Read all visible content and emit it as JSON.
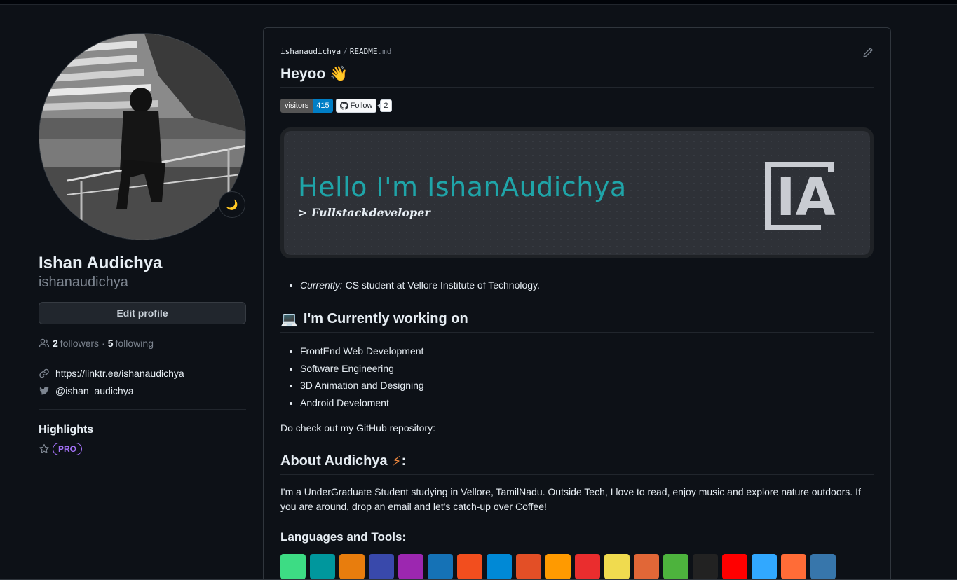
{
  "sidebar": {
    "name": "Ishan Audichya",
    "login": "ishanaudichya",
    "edit_profile": "Edit profile",
    "followers_count": "2",
    "followers_label": "followers",
    "separator": "·",
    "following_count": "5",
    "following_label": "following",
    "website": "https://linktr.ee/ishanaudichya",
    "twitter": "@ishan_audichya",
    "highlights_title": "Highlights",
    "pro_label": "PRO",
    "status_emoji": "🌙"
  },
  "readme": {
    "owner": "ishanaudichya",
    "separator": "/",
    "filename": "README",
    "ext": ".md",
    "heading": "Heyoo 👋",
    "badges": {
      "visitors_label": "visitors",
      "visitors_count": "415",
      "follow_label": "Follow",
      "follow_count": "2"
    },
    "banner": {
      "title": "Hello I'm IshanAudichya",
      "subtitle": "> Fullstackdeveloper",
      "logo_text": "IA"
    },
    "currently_label": "Currently:",
    "currently_text": " CS student at Vellore Institute of Technology.",
    "working_heading": "I'm Currently working on",
    "working_emoji": "💻",
    "working_items": [
      "FrontEnd Web Development",
      "Software Engineering",
      "3D Animation and Designing",
      "Android Develoment"
    ],
    "repo_text": "Do check out my GitHub repository:",
    "about_heading": "About Audichya",
    "about_emoji": "⚡",
    "about_colon": " :",
    "about_text": "I'm a UnderGraduate Student studying in Vellore, TamilNadu. Outside Tech, I love to read, enjoy music and explore nature outdoors. If you are around, drop an email and let's catch-up over Coffee!",
    "tools_heading": "Languages and Tools:",
    "tools": [
      {
        "icon": "android-icon",
        "color": "#3ddc84"
      },
      {
        "icon": "arduino-icon",
        "color": "#00979d"
      },
      {
        "icon": "blender-icon",
        "color": "#e87d0d"
      },
      {
        "icon": "c-icon",
        "color": "#3949ab"
      },
      {
        "icon": "cplusplus-icon",
        "color": "#9c27b0"
      },
      {
        "icon": "css-icon",
        "color": "#1572b6"
      },
      {
        "icon": "figma-icon",
        "color": "#f24e1e"
      },
      {
        "icon": "azure-icon",
        "color": "#0089d6"
      },
      {
        "icon": "html-icon",
        "color": "#e34f26"
      },
      {
        "icon": "illustrator-icon",
        "color": "#ff9a00"
      },
      {
        "icon": "java-icon",
        "color": "#ea2d2e"
      },
      {
        "icon": "javascript-icon",
        "color": "#f0db4f"
      },
      {
        "icon": "matlab-icon",
        "color": "#e16737"
      },
      {
        "icon": "mongodb-icon",
        "color": "#4db33d"
      },
      {
        "icon": "unity-icon",
        "color": "#222222"
      },
      {
        "icon": "opencv-icon",
        "color": "#ff0000"
      },
      {
        "icon": "photoshop-icon",
        "color": "#31a8ff"
      },
      {
        "icon": "postman-icon",
        "color": "#ff6c37"
      },
      {
        "icon": "python-icon",
        "color": "#3776ab"
      }
    ]
  }
}
